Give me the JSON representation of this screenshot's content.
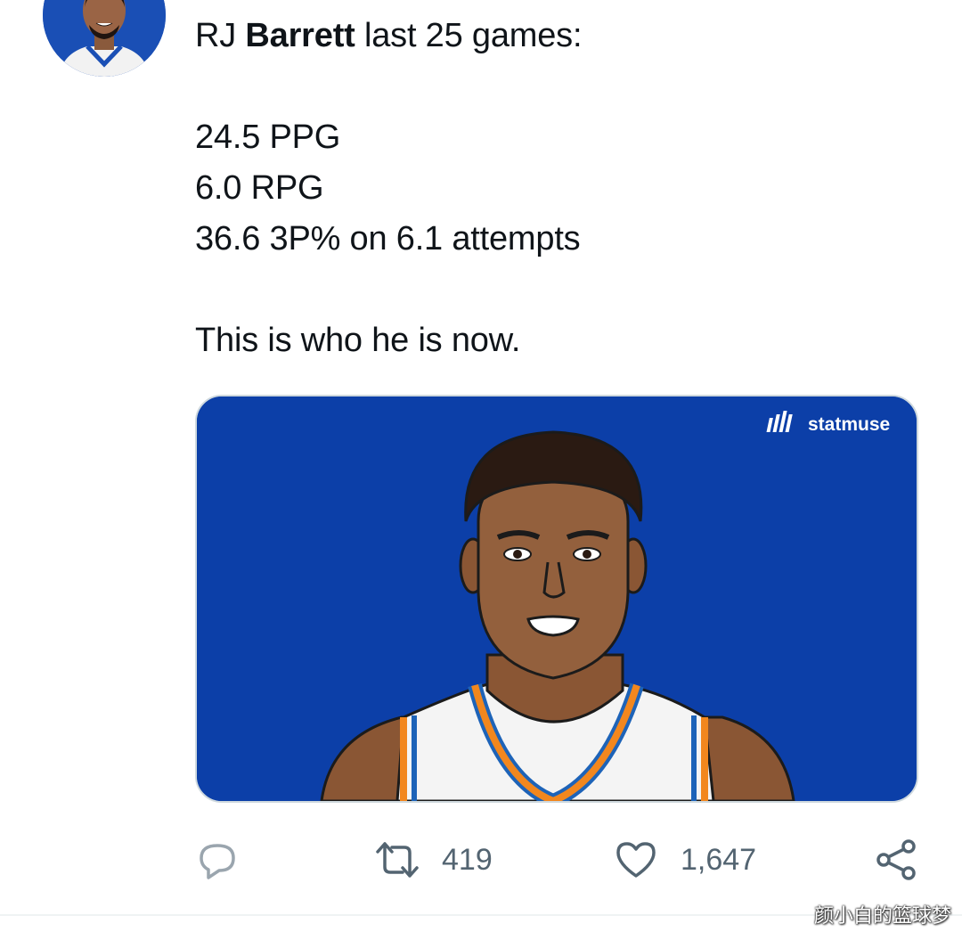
{
  "tweet": {
    "author_first": "RJ ",
    "author_bold": "Barrett",
    "headline_rest": " last 25 games:",
    "stats": [
      "24.5 PPG",
      "6.0 RPG",
      "36.6 3P% on 6.1 attempts"
    ],
    "closing": "This is who he is now."
  },
  "media": {
    "brand": "statmuse",
    "brand_icon": "statmuse-logo-icon",
    "background_color": "#0c3fa8"
  },
  "actions": {
    "reply_icon": "reply-icon",
    "retweet_icon": "retweet-icon",
    "retweet_count": "419",
    "like_icon": "heart-icon",
    "like_count": "1,647",
    "share_icon": "share-icon"
  },
  "watermark": "颜小白的篮球梦"
}
